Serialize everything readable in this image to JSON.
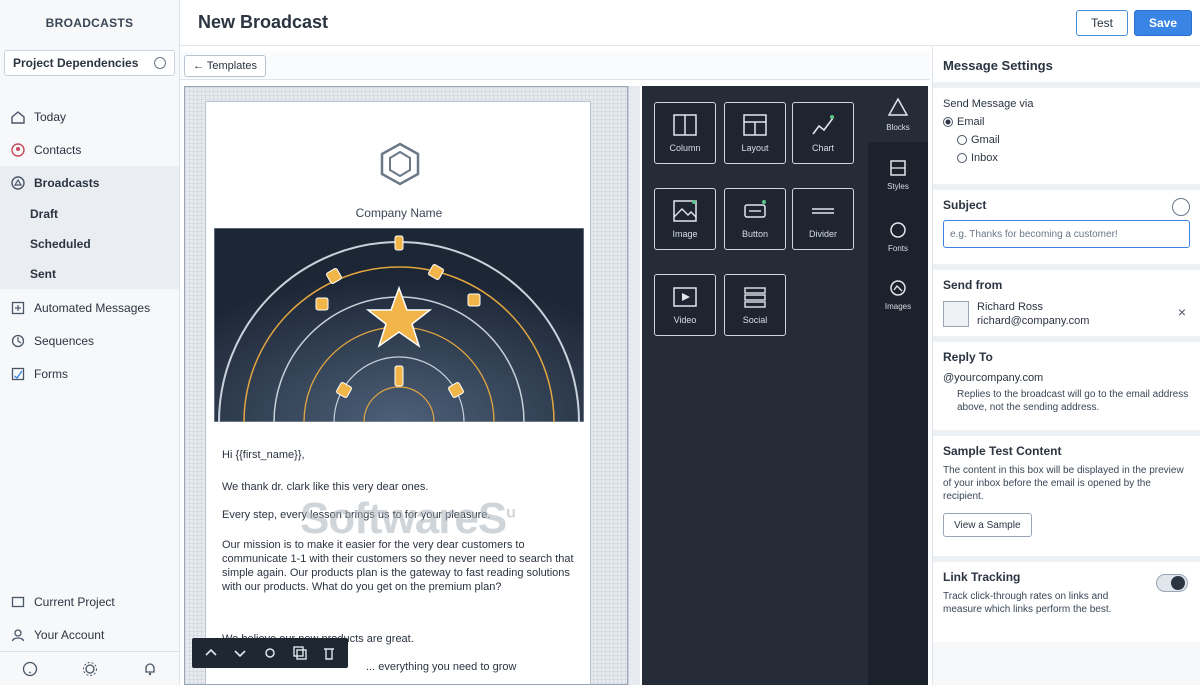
{
  "sidebar": {
    "brand": "BROADCASTS",
    "workspace": "Project Dependencies",
    "nav": [
      {
        "label": "Today"
      },
      {
        "label": "Contacts"
      }
    ],
    "broadcasts": {
      "label": "Broadcasts",
      "subitems": [
        "Draft",
        "Scheduled",
        "Sent"
      ]
    },
    "nav2": [
      {
        "label": "Automated Messages"
      },
      {
        "label": "Sequences"
      },
      {
        "label": "Forms"
      }
    ],
    "bottom": [
      {
        "label": "Current Project"
      },
      {
        "label": "Your Account"
      }
    ]
  },
  "header": {
    "title": "New Broadcast",
    "test_label": "Test",
    "save_label": "Save"
  },
  "toolbar": {
    "templates_label": "← Templates"
  },
  "email": {
    "company_name": "Company Name",
    "greeting": "Hi {{first_name}},",
    "p1": "We thank dr. clark like this very dear ones.",
    "p2": "Every step, every lesson brings us to for your pleasure.",
    "p3": "Our mission is to make it easier for the very dear customers to communicate 1-1 with their customers so they never need to search that simple again. Our products plan is the gateway to fast reading solutions with our products. What do you get on the premium plan?",
    "p4": "We believe our new products are great.",
    "p5": "... everything you need to grow",
    "watermark": "SoftwareS",
    "watermark_sup": "u"
  },
  "blocks": [
    {
      "label": "Column"
    },
    {
      "label": "Layout"
    },
    {
      "label": "Chart"
    },
    {
      "label": "Image"
    },
    {
      "label": "Button"
    },
    {
      "label": "Divider"
    },
    {
      "label": "Video"
    },
    {
      "label": "Social"
    }
  ],
  "block_tabs": [
    {
      "label": "Blocks"
    },
    {
      "label": "Styles"
    },
    {
      "label": "Fonts"
    },
    {
      "label": "Images"
    }
  ],
  "settings": {
    "title": "Message Settings",
    "send_label": "Send Message via",
    "send_options": [
      "Email",
      "Gmail",
      "Inbox"
    ],
    "subject_label": "Subject",
    "subject_placeholder": "e.g. Thanks for becoming a customer!",
    "sender_label": "Send from",
    "sender_name": "Richard Ross",
    "sender_email": "richard@company.com",
    "reply_label": "Reply To",
    "reply_email": "@yourcompany.com",
    "reply_note": "Replies to the broadcast will go to the email address above, not the sending address.",
    "preview_label": "Sample Test Content",
    "preview_text": "The content in this box will be displayed in the preview of your inbox before the email is opened by the recipient.",
    "preview_button": "View a Sample",
    "unsub_label": "Link Tracking",
    "unsub_text": "Track click-through rates on links and measure which links perform the best."
  }
}
